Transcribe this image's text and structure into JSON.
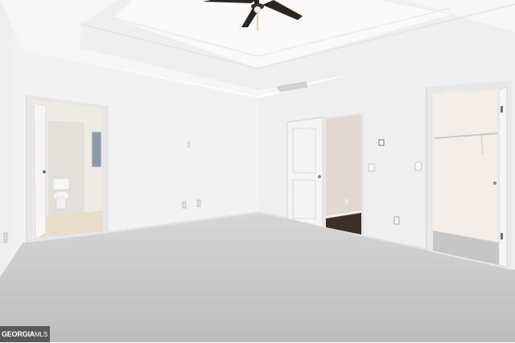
{
  "photo": {
    "subject": "empty-bedroom-interior",
    "watermark": {
      "brand": "GEORGIA",
      "suffix": "MLS"
    }
  },
  "colors": {
    "wall": "#f2f2f2",
    "ceiling": "#f7f7f7",
    "carpet": "#c9c9c9",
    "door": "#f4f4f4",
    "dark_floor": "#3c2f27",
    "fan": "#2c2622"
  }
}
